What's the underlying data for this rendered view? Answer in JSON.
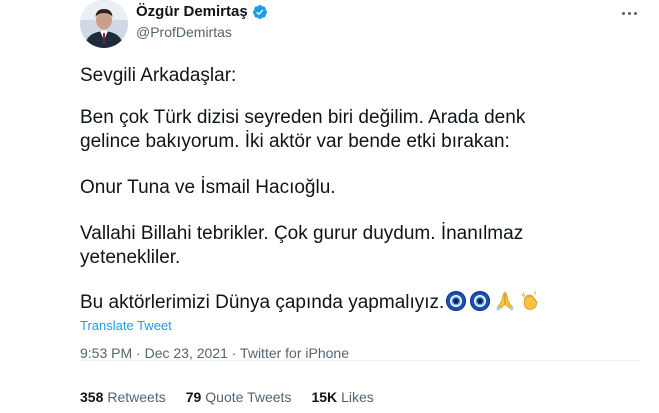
{
  "author": {
    "display_name": "Özgür Demirtaş",
    "handle": "@ProfDemirtas",
    "verified": true,
    "avatar_icon": "person-portrait-avatar",
    "verified_icon": "verified-badge-icon"
  },
  "tweet": {
    "lines": [
      "Sevgili Arkadaşlar:",
      "Ben çok Türk dizisi seyreden biri değilim. Arada denk",
      "gelince bakıyorum. İki aktör var bende etki bırakan:",
      "Onur Tuna ve İsmail Hacıoğlu.",
      "Vallahi Billahi tebrikler. Çok gurur duydum. İnanılmaz",
      "yetenekliler.",
      "Bu aktörlerimizi Dünya çapında yapmalıyız."
    ],
    "trailing_emojis": [
      "nazar-amulet-emoji",
      "nazar-amulet-emoji",
      "folded-hands-emoji",
      "clapping-hands-emoji"
    ],
    "translate_label": "Translate Tweet",
    "timestamp": "9:53 PM · Dec 23, 2021 · Twitter for iPhone"
  },
  "stats": {
    "retweets_count": "358",
    "retweets_label": "Retweets",
    "quotes_count": "79",
    "quotes_label": "Quote Tweets",
    "likes_count": "15K",
    "likes_label": "Likes"
  },
  "colors": {
    "text": "#0f1419",
    "secondary": "#536471",
    "link": "#1d9bf0",
    "verified": "#1d9bf0"
  }
}
